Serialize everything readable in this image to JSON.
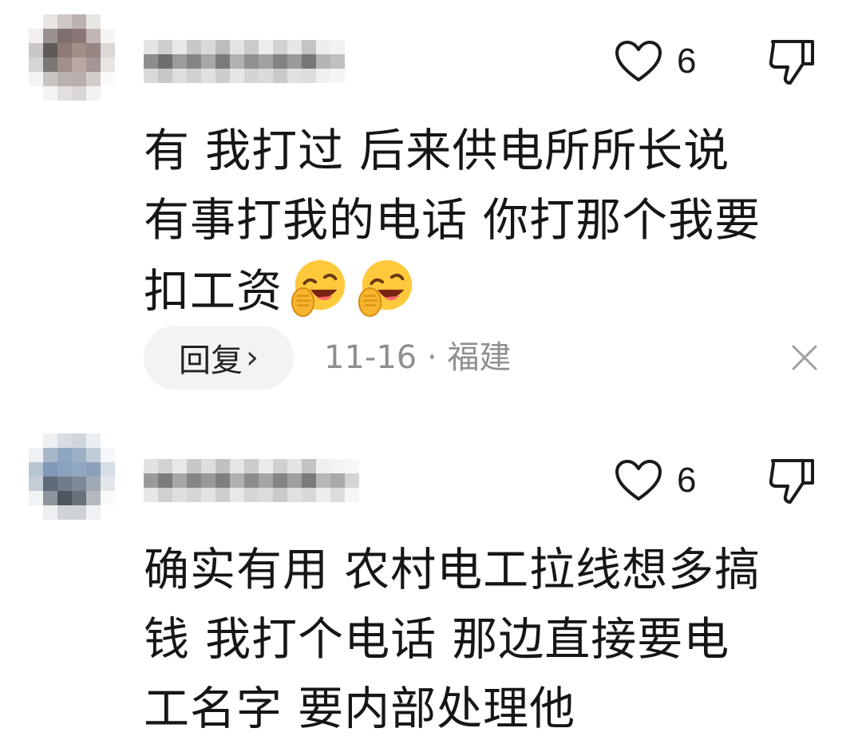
{
  "comments": [
    {
      "like_count": "6",
      "lines": [
        "有 我打过 后来供电所所长说",
        "有事打我的电话 你打那个我要",
        "扣工资"
      ],
      "emojis": [
        "laughing-crying-emoji",
        "laughing-crying-emoji"
      ],
      "reply_label": "回复",
      "date": "11-16",
      "separator": "·",
      "location": "福建"
    },
    {
      "like_count": "6",
      "lines": [
        "确实有用 农村电工拉线想多搞",
        "钱 我打个电话 那边直接要电",
        "工名字 要内部处理他"
      ]
    }
  ],
  "colors": {
    "meta_text": "#8f8f8f",
    "reply_bg": "#f3f3f3",
    "text": "#161616"
  }
}
